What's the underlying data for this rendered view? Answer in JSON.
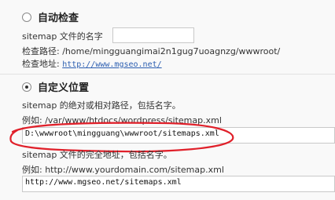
{
  "auto": {
    "title": "自动检查",
    "selected": false,
    "name_label": "sitemap 文件的名字",
    "name_value": "",
    "path_label": "检查路径: /home/mingguangimai2n1gug7uoagnzg/wwwroot/",
    "url_label": "检查地址: ",
    "url_value": "http://www.mgseo.net/"
  },
  "custom": {
    "title": "自定义位置",
    "selected": true,
    "path_hint": "sitemap 的绝对或相对路径，包括名字。",
    "path_example": "例如: /var/www/htdocs/wordpress/sitemap.xml",
    "path_value": "D:\\wwwroot\\mingguang\\wwwroot/sitemaps.xml",
    "url_hint": "sitemap 文件的完全地址，包括名字。",
    "url_example": "例如: http://www.yourdomain.com/sitemap.xml",
    "url_value": "http://www.mgseo.net/sitemaps.xml"
  },
  "annotation_color": "#e0202a"
}
